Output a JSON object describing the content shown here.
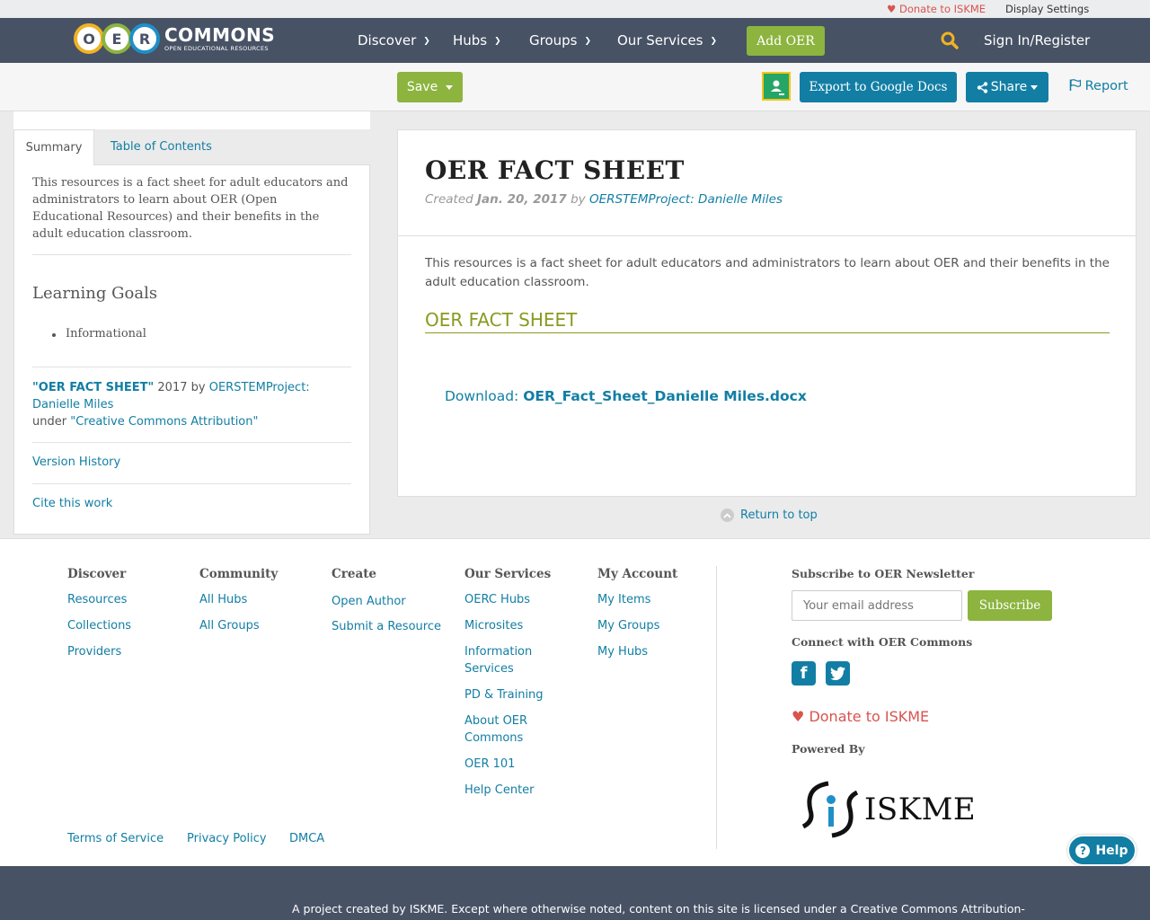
{
  "utility": {
    "donate": "Donate to ISKME",
    "display_settings": "Display Settings"
  },
  "brand": {
    "logo_letters": [
      "O",
      "E",
      "R"
    ],
    "logo_word": "COMMONS",
    "logo_tagline": "OPEN EDUCATIONAL RESOURCES"
  },
  "nav": {
    "items": [
      "Discover",
      "Hubs",
      "Groups",
      "Our Services"
    ],
    "add_oer": "Add OER",
    "sign_in": "Sign In/Register"
  },
  "toolbar": {
    "save": "Save",
    "export": "Export to Google Docs",
    "share": "Share",
    "report": "Report"
  },
  "sidebar": {
    "tabs": [
      "Summary",
      "Table of Contents"
    ],
    "summary": "This resources is a fact sheet for adult educators and administrators to learn about OER (Open Educational Resources) and their benefits in the adult education classroom.",
    "learning_goals_heading": "Learning Goals",
    "learning_goals": [
      "Informational"
    ],
    "attribution": {
      "title": "\"OER FACT SHEET\"",
      "year_by": " 2017 by ",
      "author": "OERSTEMProject: Danielle Miles",
      "under": "under ",
      "license": "\"Creative Commons Attribution\""
    },
    "version_history": "Version History",
    "cite": "Cite this work"
  },
  "resource": {
    "title": "OER FACT SHEET",
    "created_label": "Created",
    "date": "Jan. 20, 2017",
    "by_label": "by",
    "author": "OERSTEMProject: Danielle Miles",
    "description": "This resources is a fact sheet for adult educators and administrators to learn about OER and their benefits in the adult education classroom.",
    "section_heading": "OER FACT SHEET",
    "download_label": "Download:",
    "download_file": "OER_Fact_Sheet_Danielle Miles.docx"
  },
  "return_to_top": "Return to top",
  "footer": {
    "columns": [
      {
        "heading": "Discover",
        "links": [
          "Resources",
          "Collections",
          "Providers"
        ]
      },
      {
        "heading": "Community",
        "links": [
          "All Hubs",
          "All Groups"
        ]
      },
      {
        "heading": "Create",
        "links": [
          "Open Author",
          "Submit a Resource"
        ]
      },
      {
        "heading": "Our Services",
        "links": [
          "OERC Hubs",
          "Microsites",
          "Information Services",
          "PD & Training",
          "About OER Commons",
          "OER 101",
          "Help Center"
        ]
      },
      {
        "heading": "My Account",
        "links": [
          "My Items",
          "My Groups",
          "My Hubs"
        ]
      }
    ],
    "newsletter_heading": "Subscribe to OER Newsletter",
    "email_placeholder": "Your email address",
    "subscribe": "Subscribe",
    "connect_heading": "Connect with OER Commons",
    "donate": "Donate to ISKME",
    "powered_by": "Powered By",
    "iskme": "ISKME",
    "legal": [
      "Terms of Service",
      "Privacy Policy",
      "DMCA"
    ],
    "help": "Help"
  },
  "bottom_text": "A project created by ISKME. Except where otherwise noted, content on this site is licensed under a Creative Commons Attribution-",
  "colors": {
    "nav_bg": "#475265",
    "accent_green": "#8cb43f",
    "link_blue": "#127ea4",
    "donate_red": "#d9534f",
    "heading_olive": "#8a9a20"
  }
}
